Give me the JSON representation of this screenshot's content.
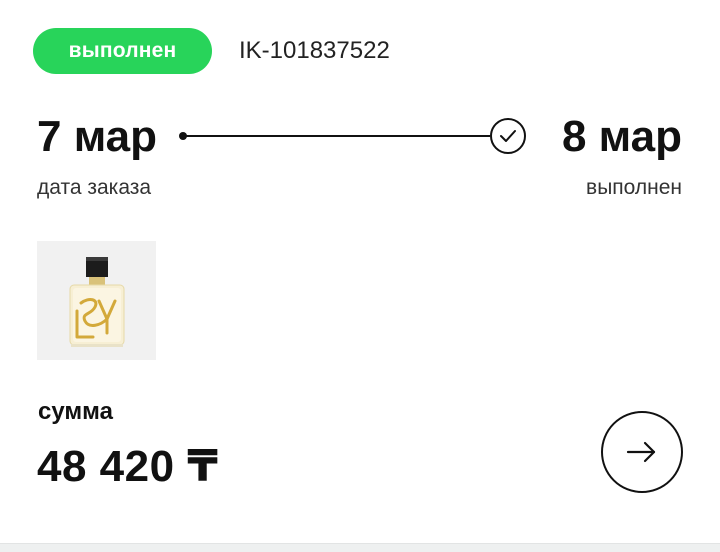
{
  "order": {
    "status": "выполнен",
    "id": "IK-101837522"
  },
  "timeline": {
    "start_date": "7 мар",
    "start_label": "дата заказа",
    "end_date": "8 мар",
    "end_label": "выполнен"
  },
  "product": {
    "icon": "perfume-bottle-image"
  },
  "total": {
    "label": "сумма",
    "value": "48 420 ₸"
  },
  "actions": {
    "open_icon": "arrow-right-icon"
  },
  "colors": {
    "status_green": "#28d45a",
    "text": "#111111",
    "thumb_bg": "#f1f1f1"
  }
}
